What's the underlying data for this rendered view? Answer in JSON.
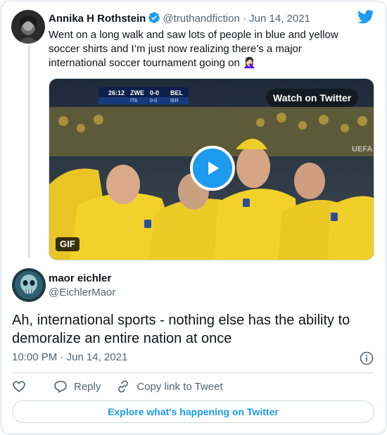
{
  "quoted_tweet": {
    "author_name": "Annika H Rothstein",
    "verified": true,
    "handle": "@truthandfiction",
    "separator": " · ",
    "date": "Jun 14, 2021",
    "text": "Went on a long walk and saw lots of people in blue and yellow soccer shirts and I’m just now realizing there’s a major international soccer tournament going on 🤦🏻‍♀️",
    "avatar_icon": "woman-portrait-avatar",
    "media": {
      "watch_label": "Watch on Twitter",
      "gif_badge": "GIF",
      "scoreboard": {
        "clock": "26:12",
        "team_home": "ZWE",
        "score": "0-0",
        "team_away": "BEL",
        "sub_home": "ITA",
        "sub_score": "0-0",
        "sub_away": "IER"
      },
      "watermark": "UEFA"
    }
  },
  "main_tweet": {
    "author_name": "maor eichler",
    "handle": "@EichlerMaor",
    "avatar_icon": "skull-avatar",
    "text": "Ah, international sports - nothing else has the ability to demoralize an entire nation at once",
    "time": "10:00 PM",
    "separator": " · ",
    "date": "Jun 14, 2021"
  },
  "actions": {
    "reply_label": "Reply",
    "copy_label": "Copy link to Tweet"
  },
  "explore_label": "Explore what's happening on Twitter",
  "colors": {
    "twitter_blue": "#1d9bf0",
    "text_primary": "#0f1419",
    "text_secondary": "#536471",
    "border": "#cfd9de",
    "jersey_yellow": "#f2d22a"
  }
}
